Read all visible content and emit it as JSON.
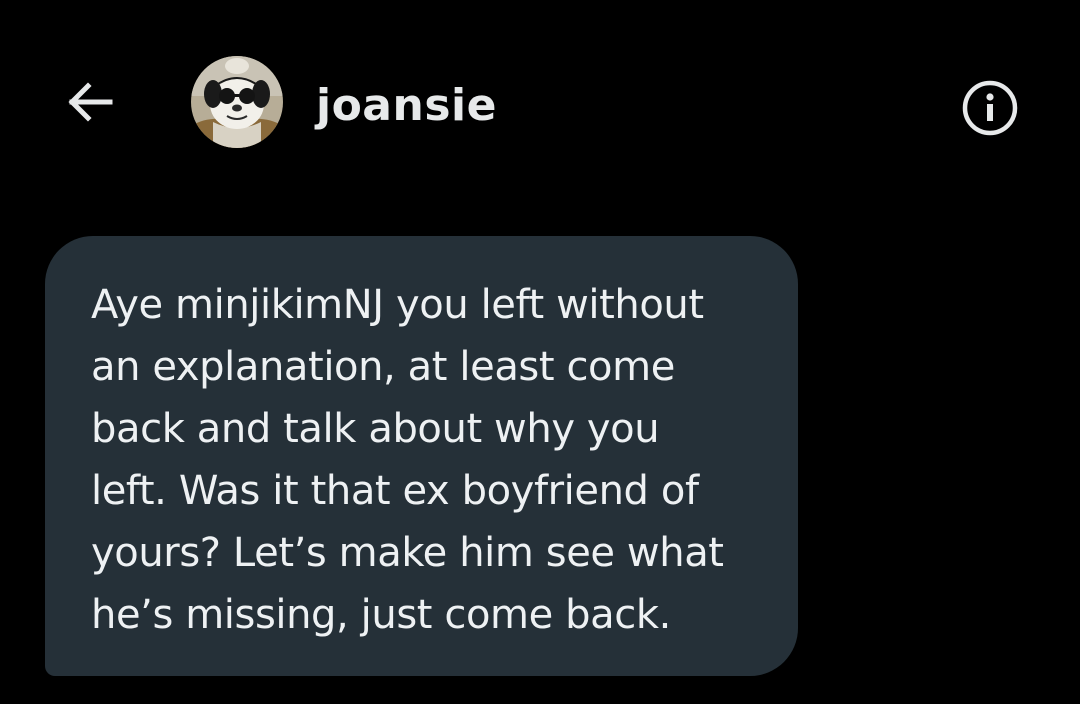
{
  "header": {
    "back_icon": "arrow-left-icon",
    "username": "joansie",
    "avatar": "avatar-cartoon-dog-sunglasses",
    "info_icon": "info-circle-icon"
  },
  "message": {
    "text": "Aye minjikimNJ you left without\nan explanation, at least come\nback and talk about why you\nleft. Was it that ex boyfriend of\nyours? Let’s make him see what\nhe’s missing, just come back."
  },
  "colors": {
    "background": "#000000",
    "bubble": "#253038",
    "text": "#e7e9ea"
  }
}
